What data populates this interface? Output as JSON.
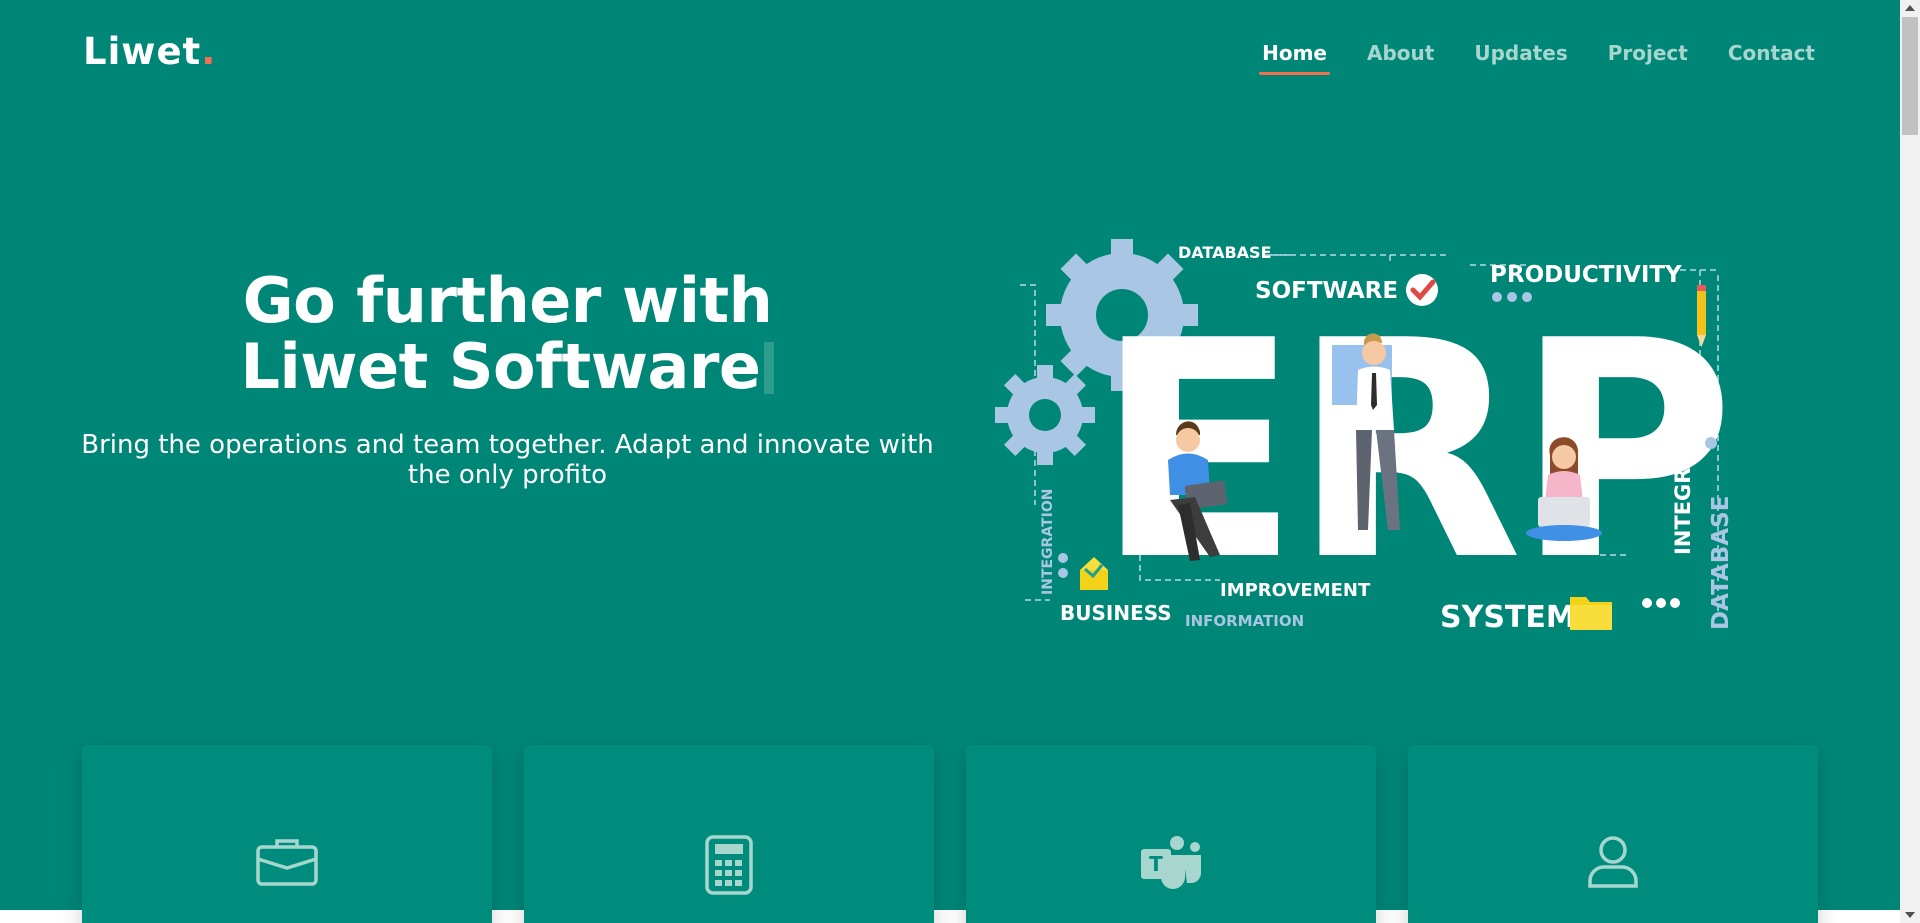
{
  "brand": {
    "name": "Liwet",
    "dot": "."
  },
  "nav": {
    "items": [
      {
        "label": "Home",
        "active": true
      },
      {
        "label": "About"
      },
      {
        "label": "Updates"
      },
      {
        "label": "Project"
      },
      {
        "label": "Contact"
      }
    ]
  },
  "hero": {
    "title_line1": "Go further with",
    "title_line2": "Liwet Software",
    "subtitle": "Bring the operations and team together. Adapt and innovate with the only profito"
  },
  "illustration": {
    "big_letters": "ERP",
    "labels": {
      "database": "DATABASE",
      "software": "SOFTWARE",
      "productivity": "PRODUCTIVITY",
      "integration": "INTEGRATION",
      "database_vertical": "DATABASE",
      "integration_left": "INTEGRATION",
      "improvement": "IMPROVEMENT",
      "business": "BUSINESS",
      "information": "INFORMATION",
      "system": "SYSTEM"
    }
  },
  "cards": [
    {
      "icon": "briefcase-icon"
    },
    {
      "icon": "calculator-icon"
    },
    {
      "icon": "teams-icon"
    },
    {
      "icon": "user-icon"
    }
  ],
  "colors": {
    "hero_bg": "#008677",
    "accent": "#f37052",
    "card_bg": "#008c7d",
    "nav_inactive": "#a7d6cf"
  }
}
